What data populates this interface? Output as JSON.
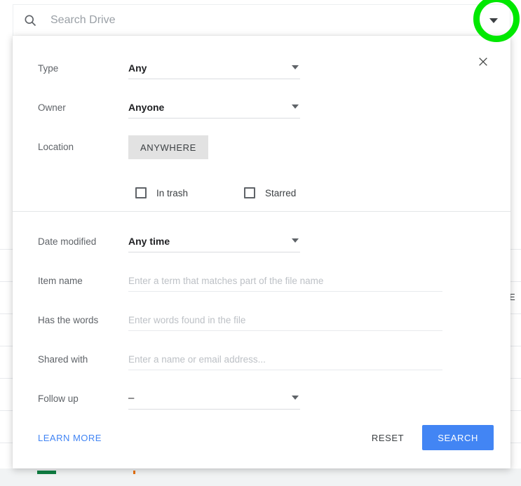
{
  "search": {
    "placeholder": "Search Drive",
    "value": "",
    "search_icon": "search-icon",
    "toggle_icon": "chevron-down-icon",
    "highlight_color": "#00e800"
  },
  "panel": {
    "close_icon": "close-icon",
    "top_fields": [
      {
        "label": "Type",
        "value": "Any",
        "control": "select"
      },
      {
        "label": "Owner",
        "value": "Anyone",
        "control": "select"
      },
      {
        "label": "Location",
        "value": "ANYWHERE",
        "control": "chip-button"
      }
    ],
    "checkboxes": [
      {
        "label": "In trash",
        "checked": false
      },
      {
        "label": "Starred",
        "checked": false
      }
    ],
    "bottom_fields": [
      {
        "label": "Date modified",
        "value": "Any time",
        "control": "select",
        "placeholder": ""
      },
      {
        "label": "Item name",
        "value": "",
        "control": "text",
        "placeholder": "Enter a term that matches part of the file name"
      },
      {
        "label": "Has the words",
        "value": "",
        "control": "text",
        "placeholder": "Enter words found in the file"
      },
      {
        "label": "Shared with",
        "value": "",
        "control": "text",
        "placeholder": "Enter a name or email address..."
      },
      {
        "label": "Follow up",
        "value": "–",
        "control": "select",
        "placeholder": ""
      }
    ],
    "footer": {
      "learn_more": "LEARN MORE",
      "reset": "RESET",
      "search": "SEARCH",
      "accent_color": "#4285f4"
    }
  },
  "background": {
    "row_label": "E",
    "rows": 8
  }
}
